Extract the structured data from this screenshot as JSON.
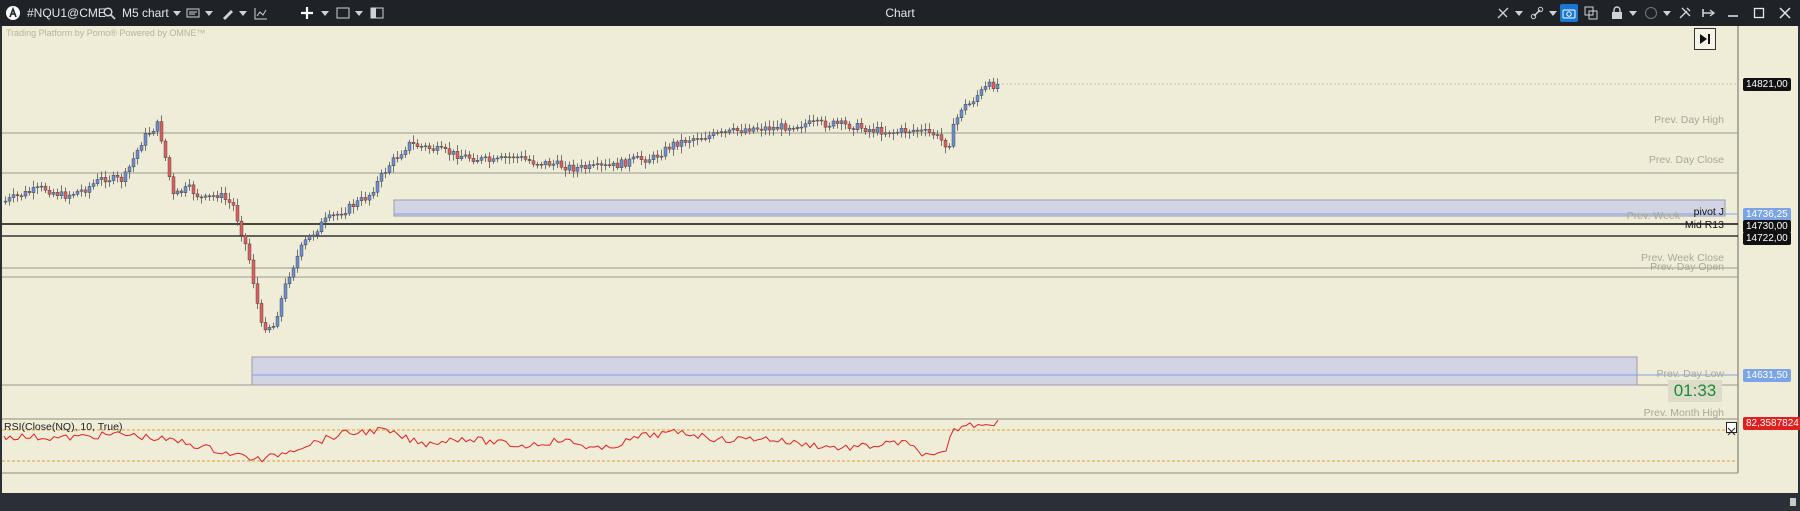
{
  "toolbar": {
    "symbol": "#NQU1@CME",
    "timeframe": "M5 chart",
    "window_title": "Chart"
  },
  "watermark": "Trading Platform by Pomo® Powered by OMNE™",
  "price_scale": {
    "last_price": "14821,00",
    "pivot_price": "14736,25",
    "mid_price": "14730,00",
    "low_line_price": "14722,00",
    "day_low_price": "14631,50",
    "rsi_value": "82,3587824"
  },
  "levels": {
    "prev_day_high": "Prev. Day High",
    "prev_day_close": "Prev. Day Close",
    "prev_week": "Prev. Week",
    "pivot": "pivot J",
    "mid": "Mid R13",
    "prev_week_close": "Prev. Week Close",
    "prev_day_open": "Prev. Day Open",
    "prev_day_low": "Prev. Day Low",
    "prev_month_high": "Prev. Month High"
  },
  "countdown": "01:33",
  "indicator": {
    "label": "RSI(Close(NQ), 10, True)"
  },
  "colors": {
    "background": "#efedd8",
    "candle_up": "#6b8fd6",
    "candle_down": "#e06060",
    "rsi_line": "#e02020",
    "accent": "#1976d2"
  },
  "icons": [
    "app-logo-icon",
    "search-icon",
    "dropdown-icon",
    "chart-type-icon",
    "pencil-icon",
    "indicator-icon",
    "crosshair-icon",
    "window-icon",
    "layout-icon",
    "camera-icon",
    "link-icon",
    "lock-icon",
    "circle-icon",
    "tools-icon",
    "pin-icon",
    "minimize-icon",
    "maximize-icon",
    "close-icon",
    "goto-end-icon"
  ]
}
